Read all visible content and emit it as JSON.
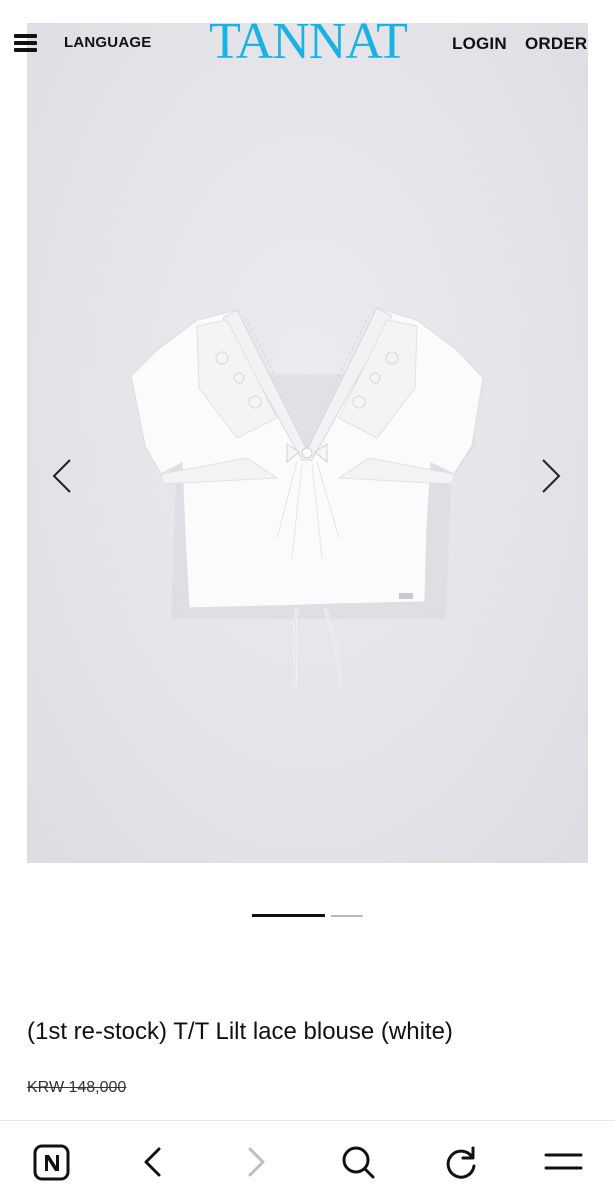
{
  "header": {
    "language_label": "LANGUAGE",
    "logo_text": "TANNAT",
    "login_label": "LOGIN",
    "order_label": "ORDER",
    "logo_color": "#1ab2e4"
  },
  "gallery": {
    "image_alt": "white lace blouse product photo",
    "current_slide": 1,
    "total_slides": 2,
    "prev_icon": "chevron-left-icon",
    "next_icon": "chevron-right-icon"
  },
  "product": {
    "title": "(1st re-stock) T/T Lilt lace blouse (white)",
    "price": "KRW 148,000"
  },
  "browser_bar": {
    "icons": [
      "home-n-icon",
      "back-icon",
      "forward-icon",
      "search-icon",
      "reload-icon",
      "menu-icon"
    ]
  }
}
